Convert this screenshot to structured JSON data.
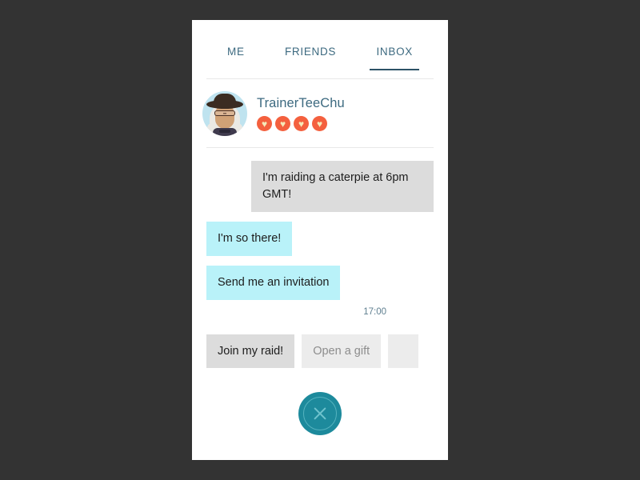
{
  "window": {
    "background_color": "#333333",
    "card_background": "#ffffff"
  },
  "tabs": [
    {
      "label": "ME",
      "active": false
    },
    {
      "label": "FRIENDS",
      "active": false
    },
    {
      "label": "INBOX",
      "active": true
    }
  ],
  "profile": {
    "username": "TrainerTeeChu",
    "avatar_icon": "trainer-avatar-icon",
    "hearts": [
      {
        "icon": "heart-icon",
        "glyph": "♥"
      },
      {
        "icon": "heart-icon",
        "glyph": "♥"
      },
      {
        "icon": "heart-icon",
        "glyph": "♥"
      },
      {
        "icon": "heart-icon",
        "glyph": "♥"
      }
    ],
    "heart_count": 4
  },
  "conversation": {
    "messages": [
      {
        "text": "I'm raiding a caterpie at 6pm GMT!",
        "direction": "incoming"
      },
      {
        "text": "I'm so there!",
        "direction": "outgoing"
      },
      {
        "text": "Send me an invitation",
        "direction": "outgoing"
      }
    ],
    "timestamp": "17:00"
  },
  "quick_replies": [
    {
      "label": "Join my raid!",
      "style": "primary"
    },
    {
      "label": "Open a gift",
      "style": "secondary"
    },
    {
      "label": "",
      "style": "blank"
    }
  ],
  "close_button": {
    "icon": "close-x-icon",
    "color": "#1d8a9c"
  },
  "colors": {
    "accent_teal": "#1d8a9c",
    "tab_text": "#3d6a80",
    "tab_underline": "#2d5266",
    "bubble_incoming": "#dcdcdc",
    "bubble_outgoing": "#b9f2f9",
    "heart_badge": "#f4603e",
    "heart_fill": "#f5e9b8",
    "timestamp_text": "#5f7f90"
  }
}
